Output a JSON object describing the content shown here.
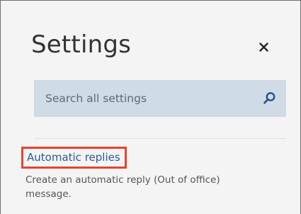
{
  "settings": {
    "title": "Settings",
    "close_icon": "close-icon",
    "search": {
      "placeholder": "Search all settings",
      "value": "",
      "icon": "search-icon"
    },
    "items": [
      {
        "label": "Automatic replies",
        "description": "Create an automatic reply (Out of office) message.",
        "highlighted": true
      }
    ]
  },
  "colors": {
    "panel_background": "#f4f4f4",
    "search_background": "#cfdbe5",
    "link": "#2a5a96",
    "highlight_border": "#e8432c",
    "title_text": "#333333"
  }
}
